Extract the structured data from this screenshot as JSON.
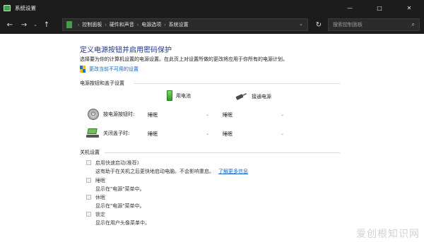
{
  "window": {
    "title": "系统设置",
    "minimize": "—",
    "maximize": "□",
    "close": "✕"
  },
  "nav": {
    "back": "←",
    "forward": "→",
    "recent": "⌄",
    "up": "↑",
    "breadcrumb": [
      "控制面板",
      "硬件和声音",
      "电源选项",
      "系统设置"
    ],
    "search_placeholder": "搜索控制面板"
  },
  "content": {
    "heading": "定义电源按钮并启用密码保护",
    "subtitle": "选择要为你的计算机设置的电源设置。在此页上对设置所做的更改将应用于你所有的电源计划。",
    "change_link": "更改当前不可用的设置",
    "section_buttons": "电源按钮和盖子设置",
    "col_battery": "用电池",
    "col_plugged": "接通电源",
    "rows": [
      {
        "label": "按电源按钮时:",
        "battery": "睡眠",
        "plugged": "睡眠"
      },
      {
        "label": "关闭盖子时:",
        "battery": "睡眠",
        "plugged": "睡眠"
      }
    ],
    "section_shutdown": "关机设置",
    "options": [
      {
        "label": "启用快速启动(推荐)",
        "desc": "这有助于在关机之后更快地启动电脑。不会影响重启。",
        "link": "了解更多信息"
      },
      {
        "label": "睡眠",
        "desc": "显示在\"电源\"菜单中。"
      },
      {
        "label": "休眠",
        "desc": "显示在\"电源\"菜单中。"
      },
      {
        "label": "锁定",
        "desc": "显示在用户头像菜单中。"
      }
    ]
  },
  "watermark": "爱创根知识网",
  "colors": {
    "titlebar_bg": "#1c1c1c",
    "heading": "#1e3287",
    "link": "#1565c0"
  }
}
